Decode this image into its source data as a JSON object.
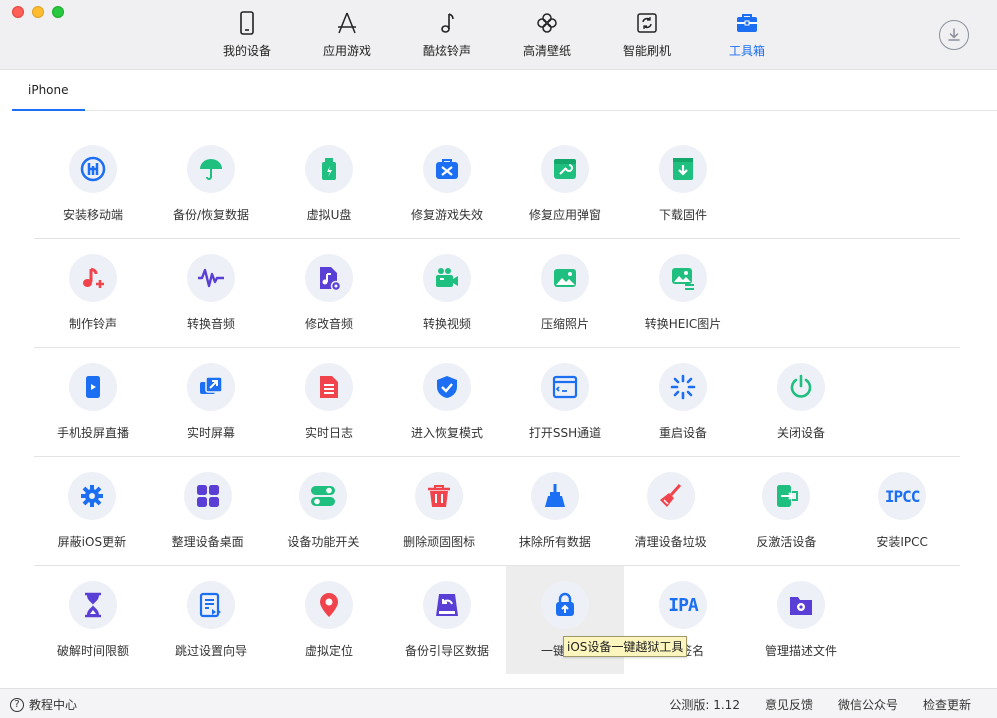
{
  "nav": [
    {
      "label": "我的设备",
      "icon": "phone-icon",
      "active": false
    },
    {
      "label": "应用游戏",
      "icon": "app-store-icon",
      "active": false
    },
    {
      "label": "酷炫铃声",
      "icon": "music-note-icon",
      "active": false
    },
    {
      "label": "高清壁纸",
      "icon": "flower-icon",
      "active": false
    },
    {
      "label": "智能刷机",
      "icon": "refresh-icon",
      "active": false
    },
    {
      "label": "工具箱",
      "icon": "toolbox-icon",
      "active": true
    }
  ],
  "tabs": [
    "iPhone"
  ],
  "rows": [
    [
      {
        "label": "安装移动端",
        "icon": "install-mobile-icon",
        "color": "#1c6ef2"
      },
      {
        "label": "备份/恢复数据",
        "icon": "umbrella-icon",
        "color": "#1fbf7f"
      },
      {
        "label": "虚拟U盘",
        "icon": "usb-drive-icon",
        "color": "#1fbf7f"
      },
      {
        "label": "修复游戏失效",
        "icon": "repair-kit-icon",
        "color": "#1c6ef2"
      },
      {
        "label": "修复应用弹窗",
        "icon": "window-wrench-icon",
        "color": "#1fbf7f"
      },
      {
        "label": "下载固件",
        "icon": "download-firmware-icon",
        "color": "#1fbf7f"
      }
    ],
    [
      {
        "label": "制作铃声",
        "icon": "ringtone-icon",
        "color": "#f0434b"
      },
      {
        "label": "转换音频",
        "icon": "waveform-icon",
        "color": "#5a3fd6"
      },
      {
        "label": "修改音频",
        "icon": "audio-file-icon",
        "color": "#5a3fd6"
      },
      {
        "label": "转换视频",
        "icon": "video-camera-icon",
        "color": "#1fbf7f"
      },
      {
        "label": "压缩照片",
        "icon": "photo-icon",
        "color": "#1fbf7f"
      },
      {
        "label": "转换HEIC图片",
        "icon": "photo-convert-icon",
        "color": "#1fbf7f"
      }
    ],
    [
      {
        "label": "手机投屏直播",
        "icon": "screen-cast-icon",
        "color": "#1c6ef2"
      },
      {
        "label": "实时屏幕",
        "icon": "live-screen-icon",
        "color": "#1c6ef2"
      },
      {
        "label": "实时日志",
        "icon": "log-icon",
        "color": "#f0434b"
      },
      {
        "label": "进入恢复模式",
        "icon": "shield-check-icon",
        "color": "#1c6ef2"
      },
      {
        "label": "打开SSH通道",
        "icon": "terminal-icon",
        "color": "#1c6ef2"
      },
      {
        "label": "重启设备",
        "icon": "restart-spinner-icon",
        "color": "#1c6ef2"
      },
      {
        "label": "关闭设备",
        "icon": "power-icon",
        "color": "#1fbf7f"
      }
    ],
    [
      {
        "label": "屏蔽iOS更新",
        "icon": "gear-icon",
        "color": "#1c6ef2"
      },
      {
        "label": "整理设备桌面",
        "icon": "grid-icon",
        "color": "#5a3fd6"
      },
      {
        "label": "设备功能开关",
        "icon": "toggle-icon",
        "color": "#1fbf7f"
      },
      {
        "label": "删除顽固图标",
        "icon": "trash-icon",
        "color": "#f0434b"
      },
      {
        "label": "抹除所有数据",
        "icon": "broom-icon",
        "color": "#1c6ef2"
      },
      {
        "label": "清理设备垃圾",
        "icon": "sweep-icon",
        "color": "#f0434b"
      },
      {
        "label": "反激活设备",
        "icon": "deactivate-icon",
        "color": "#1fbf7f"
      },
      {
        "label": "安装IPCC",
        "icon": "ipcc-icon",
        "color": "#1c6ef2",
        "text": "IPCC"
      }
    ],
    [
      {
        "label": "破解时间限额",
        "icon": "hourglass-icon",
        "color": "#5a3fd6"
      },
      {
        "label": "跳过设置向导",
        "icon": "skip-wizard-icon",
        "color": "#1c6ef2"
      },
      {
        "label": "虚拟定位",
        "icon": "location-pin-icon",
        "color": "#f0434b"
      },
      {
        "label": "备份引导区数据",
        "icon": "backup-boot-icon",
        "color": "#5a3fd6"
      },
      {
        "label": "一键越狱",
        "icon": "jailbreak-icon",
        "color": "#1c6ef2",
        "hover": true
      },
      {
        "label": "IPA签名",
        "icon": "ipa-icon",
        "color": "#1c6ef2",
        "text": "IPA"
      },
      {
        "label": "管理描述文件",
        "icon": "profile-folder-icon",
        "color": "#5a3fd6"
      }
    ]
  ],
  "tooltip": "iOS设备一键越狱工具",
  "status": {
    "help": "教程中心",
    "version": "公测版: 1.12",
    "feedback": "意见反馈",
    "wechat": "微信公众号",
    "update": "检查更新"
  }
}
